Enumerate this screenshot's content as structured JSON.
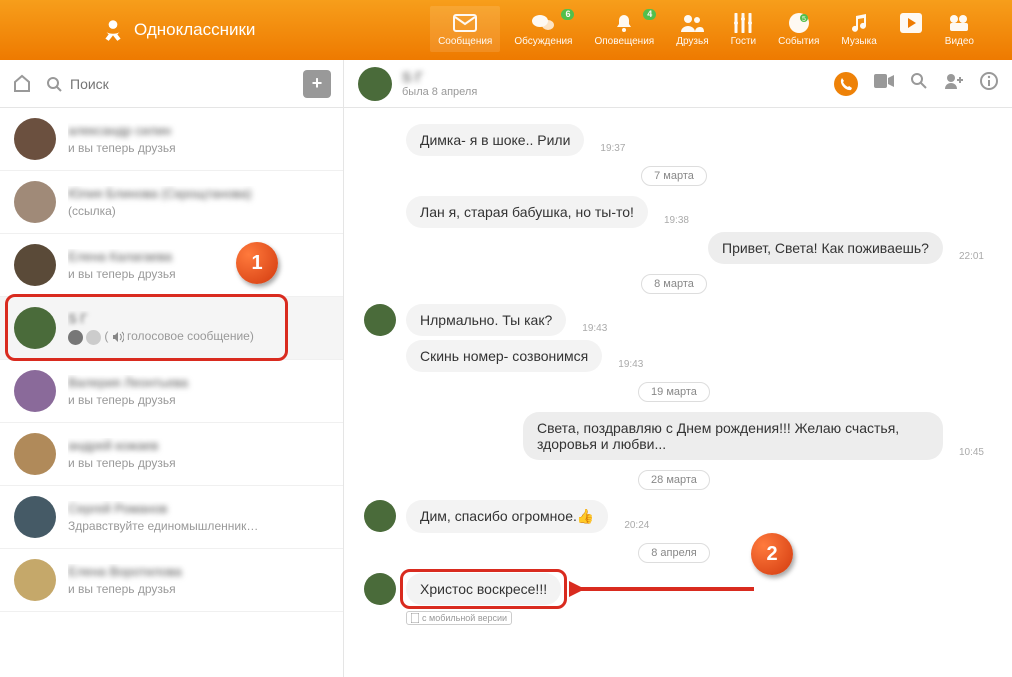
{
  "brand": "Одноклассники",
  "nav": {
    "messages": {
      "label": "Сообщения"
    },
    "discussions": {
      "label": "Обсуждения",
      "badge": "6"
    },
    "alerts": {
      "label": "Оповещения",
      "badge": "4"
    },
    "friends": {
      "label": "Друзья"
    },
    "guests": {
      "label": "Гости"
    },
    "events": {
      "label": "События"
    },
    "music": {
      "label": "Музыка"
    },
    "video": {
      "label": "Видео"
    }
  },
  "search_placeholder": "Поиск",
  "chatlist": [
    {
      "name": "александр силин",
      "sub": "и вы теперь друзья"
    },
    {
      "name": "Юлия Блинова (Скрощтанова)",
      "sub": "(ссылка)"
    },
    {
      "name": "Елена Калагаева",
      "sub": "и вы теперь друзья"
    },
    {
      "name": "S Г",
      "sub_voice": "голосовое сообщение)",
      "selected": true
    },
    {
      "name": "Валерия Леонтьева",
      "sub": "и вы теперь друзья"
    },
    {
      "name": "андрей кожаев",
      "sub": "и вы теперь друзья"
    },
    {
      "name": "Сергей Романов",
      "sub": "Здравствуйте единомышленник…"
    },
    {
      "name": "Елена Воротилова",
      "sub": "и вы теперь друзья"
    }
  ],
  "conv": {
    "title": "S Г",
    "status": "была 8 апреля",
    "messages": [
      {
        "kind": "in_alone",
        "text": "Димка- я в шоке.. Рили",
        "time": "19:37"
      },
      {
        "kind": "date",
        "text": "7 марта"
      },
      {
        "kind": "in_alone",
        "text": "Лан я, старая бабушка, но ты-то!",
        "time": "19:38"
      },
      {
        "kind": "out",
        "text": "Привет, Света! Как поживаешь?",
        "time": "22:01"
      },
      {
        "kind": "date",
        "text": "8 марта"
      },
      {
        "kind": "in_first",
        "text": "Нлрмально. Ты как?",
        "time": "19:43"
      },
      {
        "kind": "in_alone",
        "text": "Скинь номер- созвонимся",
        "time": "19:43"
      },
      {
        "kind": "date",
        "text": "19 марта"
      },
      {
        "kind": "out",
        "text": "Света, поздравляю с Днем рождения!!! Желаю счастья, здоровья и любви...",
        "time": "10:45"
      },
      {
        "kind": "date",
        "text": "28 марта"
      },
      {
        "kind": "in_first",
        "text": "Дим, спасибо огромное.👍",
        "time": "20:24"
      },
      {
        "kind": "date",
        "text": "8 апреля"
      },
      {
        "kind": "in_first",
        "text": "Христос воскресе!!!",
        "time": "",
        "highlight": true
      }
    ],
    "mobile_tag": "с мобильной версии"
  },
  "steps": {
    "one": "1",
    "two": "2"
  }
}
